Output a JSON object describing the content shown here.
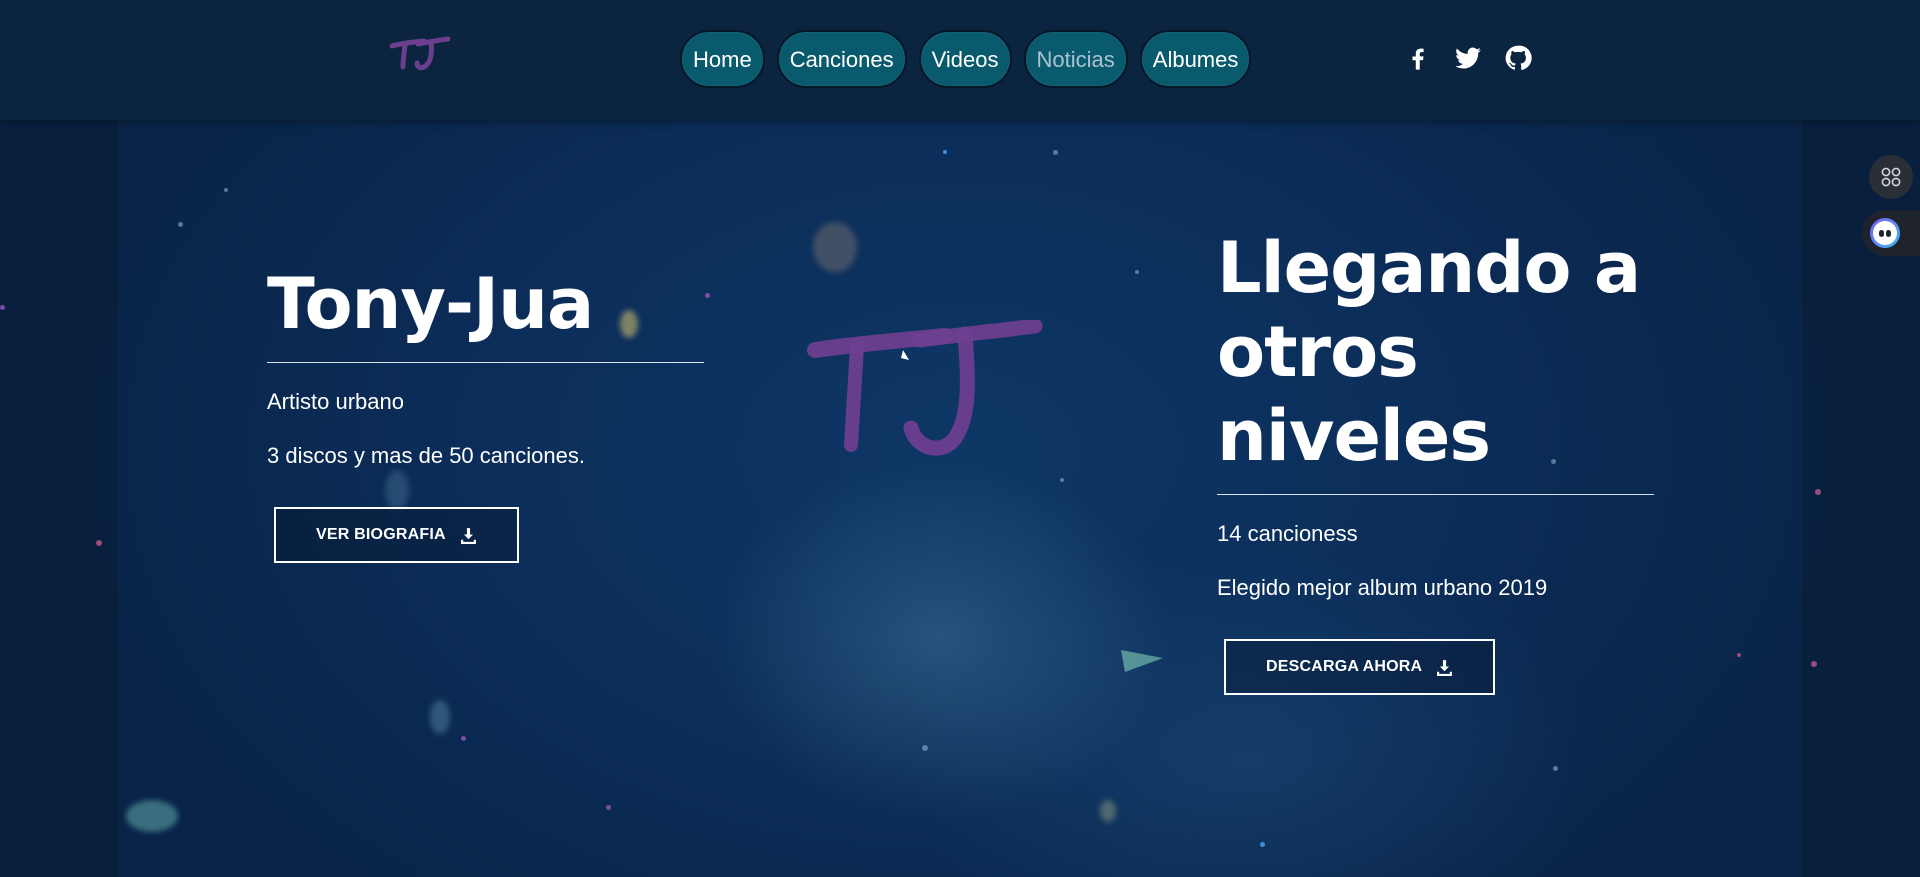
{
  "header": {
    "logo_text": "TJ",
    "nav": [
      {
        "label": "Home"
      },
      {
        "label": "Canciones"
      },
      {
        "label": "Videos"
      },
      {
        "label": "Noticias"
      },
      {
        "label": "Albumes"
      }
    ],
    "social_icons": [
      "facebook-icon",
      "twitter-icon",
      "github-icon"
    ]
  },
  "hero": {
    "center_logo_text": "TJ",
    "left": {
      "title": "Tony-Jua",
      "line1": "Artisto urbano",
      "line2": "3 discos y mas de 50 canciones.",
      "button_label": "VER BIOGRAFIA",
      "button_icon": "download-icon"
    },
    "right": {
      "title_line1": "Llegando a",
      "title_line2": "otros niveles",
      "line1": "14 cancioness",
      "line2": "Elegido mejor album urbano 2019",
      "button_label": "DESCARGA AHORA",
      "button_icon": "download-icon"
    }
  },
  "widgets": {
    "grid_icon": "apps-grid-icon",
    "assistant_icon": "assistant-face-icon"
  },
  "colors": {
    "header_bg": "#0b2440",
    "nav_pill": "#0a5a6e",
    "hero_bg": "#0b2c57",
    "logo_purple": "#6b3f8e"
  }
}
